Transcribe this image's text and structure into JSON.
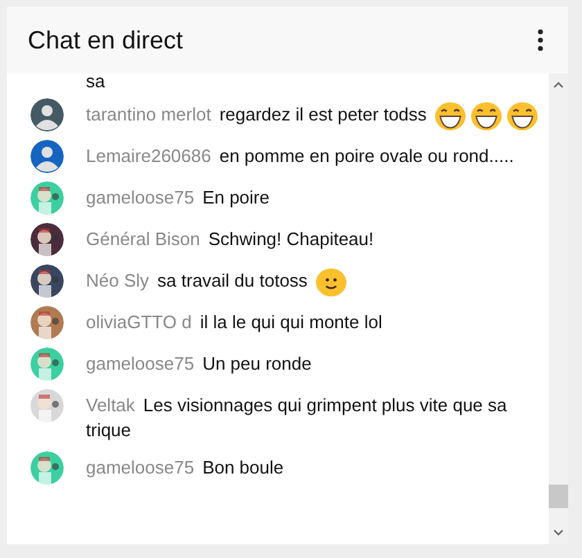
{
  "header": {
    "title": "Chat en direct"
  },
  "messages": [
    {
      "parts": [
        {
          "kind": "text",
          "text": "sa"
        }
      ]
    },
    {
      "author": "tarantino merlot",
      "avatar": {
        "kind": "silhouette",
        "color": "#455a64"
      },
      "parts": [
        {
          "kind": "text",
          "text": "regardez il est peter todss"
        },
        {
          "kind": "laugh"
        },
        {
          "kind": "laugh"
        },
        {
          "kind": "laugh"
        }
      ]
    },
    {
      "author": "Lemaire260686",
      "avatar": {
        "kind": "silhouette",
        "color": "#1565c0"
      },
      "parts": [
        {
          "kind": "text",
          "text": "en pomme en poire ovale ou rond....."
        }
      ]
    },
    {
      "author": "gameloose75",
      "avatar": {
        "kind": "picture",
        "color": "#3ccfa0"
      },
      "parts": [
        {
          "kind": "text",
          "text": "En poire"
        }
      ]
    },
    {
      "author": "Général Bison",
      "avatar": {
        "kind": "picture",
        "color": "#4a2c3a"
      },
      "parts": [
        {
          "kind": "text",
          "text": "Schwing! Chapiteau!"
        }
      ]
    },
    {
      "author": "Néo Sly",
      "avatar": {
        "kind": "picture",
        "color": "#3a4660"
      },
      "parts": [
        {
          "kind": "text",
          "text": "sa travail du totoss"
        },
        {
          "kind": "smile"
        }
      ]
    },
    {
      "author": "oliviaGTTO d",
      "avatar": {
        "kind": "picture",
        "color": "#b07a52"
      },
      "parts": [
        {
          "kind": "text",
          "text": "il la le qui qui monte lol"
        }
      ]
    },
    {
      "author": "gameloose75",
      "avatar": {
        "kind": "picture",
        "color": "#3ccfa0"
      },
      "parts": [
        {
          "kind": "text",
          "text": "Un peu ronde"
        }
      ]
    },
    {
      "author": "Veltak",
      "avatar": {
        "kind": "picture",
        "color": "#d8d8d8"
      },
      "parts": [
        {
          "kind": "text",
          "text": "Les visionnages qui grimpent plus vite que sa trique"
        }
      ]
    },
    {
      "author": "gameloose75",
      "avatar": {
        "kind": "picture",
        "color": "#3ccfa0"
      },
      "parts": [
        {
          "kind": "text",
          "text": "Bon boule"
        }
      ]
    }
  ]
}
